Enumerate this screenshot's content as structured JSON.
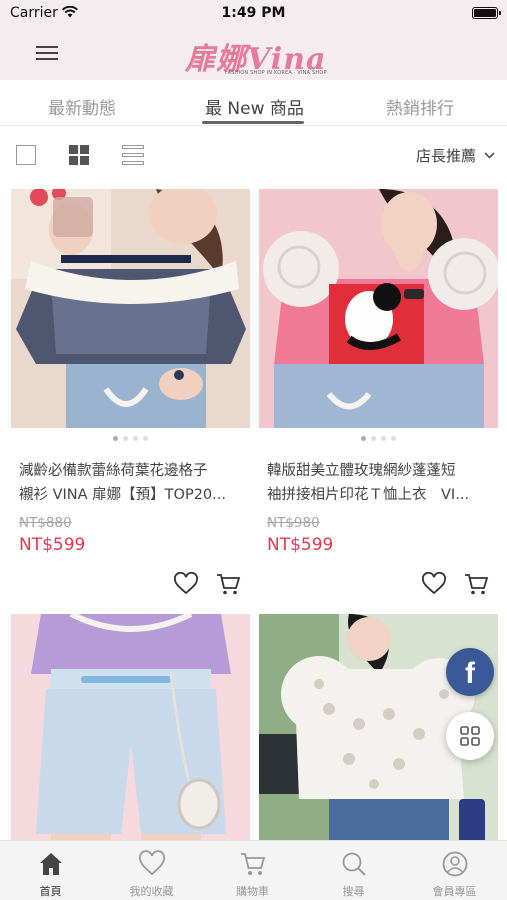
{
  "status_bar": {
    "carrier": "Carrier",
    "time": "1:49 PM"
  },
  "header": {
    "logo_text": "扉娜Vina",
    "logo_subtitle": "FASHION SHOP IN KOREA · VINA SHOP",
    "menu_icon": "hamburger-icon"
  },
  "tabs": [
    {
      "label": "最新動態",
      "active": false
    },
    {
      "label": "最 New 商品",
      "active": true
    },
    {
      "label": "熱銷排行",
      "active": false
    }
  ],
  "toolbar": {
    "view_modes": [
      "single-view-icon",
      "grid-view-icon",
      "list-view-icon"
    ],
    "sort_label": "店長推薦"
  },
  "products": [
    {
      "title_line1": "減齡必備款蕾絲荷葉花邊格子",
      "title_line2": "襯衫 VINA 扉娜【預】TOP20...",
      "old_price": "NT$880",
      "price": "NT$599"
    },
    {
      "title_line1": "韓版甜美立體玫瑰網紗蓬蓬短",
      "title_line2": "袖拼接相片印花Ｔ恤上衣　VI...",
      "old_price": "NT$980",
      "price": "NT$599"
    }
  ],
  "floating": {
    "facebook_glyph": "f"
  },
  "bottom_nav": [
    {
      "label": "首頁",
      "icon": "home-icon",
      "active": true
    },
    {
      "label": "我的收藏",
      "icon": "heart-icon",
      "active": false
    },
    {
      "label": "購物車",
      "icon": "cart-icon",
      "active": false
    },
    {
      "label": "搜尋",
      "icon": "search-icon",
      "active": false
    },
    {
      "label": "會員專區",
      "icon": "user-icon",
      "active": false
    }
  ],
  "colors": {
    "header_bg": "#f4ecee",
    "brand_pink": "#e67a9a",
    "price_red": "#e8364f",
    "facebook_blue": "#3b5998"
  }
}
